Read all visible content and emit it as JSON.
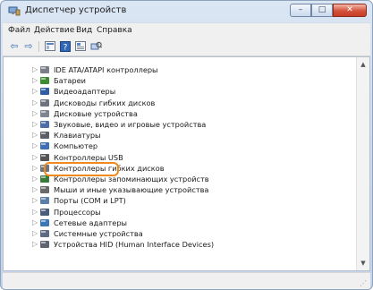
{
  "window": {
    "title": "Диспетчер устройств",
    "title_icon": "device-manager-icon",
    "caption_buttons": [
      {
        "name": "minimize",
        "glyph": "–"
      },
      {
        "name": "maximize",
        "glyph": "□"
      },
      {
        "name": "close",
        "glyph": "✕"
      }
    ]
  },
  "menu": [
    "Файл",
    "Действие",
    "Вид",
    "Справка"
  ],
  "toolbar": [
    {
      "name": "back",
      "icon": "back-arrow-icon",
      "glyph": "⇦"
    },
    {
      "name": "forward",
      "icon": "forward-arrow-icon",
      "glyph": "⇨"
    },
    {
      "name": "properties-view",
      "icon": "properties-icon"
    },
    {
      "name": "help",
      "icon": "help-icon"
    },
    {
      "name": "show-hidden",
      "icon": "view-icon"
    },
    {
      "name": "scan-hardware",
      "icon": "scan-hardware-icon"
    }
  ],
  "tree": {
    "items": [
      {
        "label": "IDE ATA/ATAPI контроллеры",
        "icon": "ide-controller-icon",
        "color": "#7a7f8a"
      },
      {
        "label": "Батареи",
        "icon": "battery-icon",
        "color": "#3c8d2f"
      },
      {
        "label": "Видеоадаптеры",
        "icon": "display-adapter-icon",
        "color": "#2e5fa6"
      },
      {
        "label": "Дисководы гибких дисков",
        "icon": "floppy-drive-icon",
        "color": "#6d7480"
      },
      {
        "label": "Дисковые устройства",
        "icon": "disk-drive-icon",
        "color": "#7d8590"
      },
      {
        "label": "Звуковые, видео и игровые устройства",
        "icon": "sound-icon",
        "color": "#4d6ea8"
      },
      {
        "label": "Клавиатуры",
        "icon": "keyboard-icon",
        "color": "#5b5f66"
      },
      {
        "label": "Компьютер",
        "icon": "computer-icon",
        "color": "#3f6fb4"
      },
      {
        "label": "Контроллеры USB",
        "icon": "usb-icon",
        "color": "#555555"
      },
      {
        "label": "Контроллеры гибких дисков",
        "icon": "floppy-controller-icon",
        "color": "#6d7480"
      },
      {
        "label": "Контроллеры запоминающих устройств",
        "icon": "storage-controller-icon",
        "color": "#3a7a3a"
      },
      {
        "label": "Мыши и иные указывающие устройства",
        "icon": "mouse-icon",
        "color": "#6a6a6a"
      },
      {
        "label": "Порты (COM и LPT)",
        "icon": "port-icon",
        "color": "#5c7fa8"
      },
      {
        "label": "Процессоры",
        "icon": "processor-icon",
        "color": "#4a5e7a"
      },
      {
        "label": "Сетевые адаптеры",
        "icon": "network-adapter-icon",
        "color": "#3a78b8"
      },
      {
        "label": "Системные устройства",
        "icon": "system-devices-icon",
        "color": "#5d6c85"
      },
      {
        "label": "Устройства HID (Human Interface Devices)",
        "icon": "hid-icon",
        "color": "#5f6470"
      }
    ],
    "highlighted": "Контроллеры USB",
    "highlight_color": "#f08a1a"
  },
  "colors": {
    "title_gradient_top": "#dbe6f4",
    "close_button": "#c63d25"
  }
}
